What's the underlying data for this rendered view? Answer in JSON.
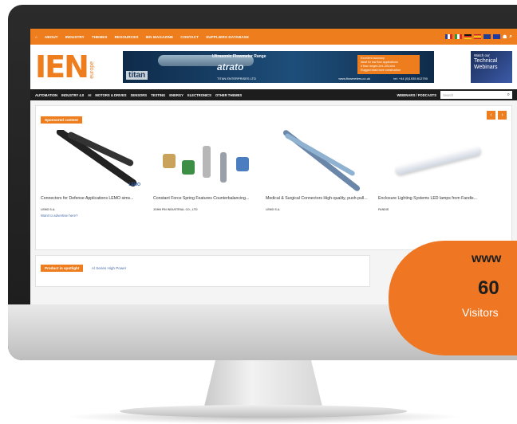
{
  "topbar": {
    "items": [
      "ABOUT",
      "INDUSTRY",
      "THEMES",
      "RESOURCES",
      "IEN MAGAZINE",
      "CONTACT",
      "SUPPLIERS DATABASE"
    ],
    "flags": [
      "fr",
      "it",
      "de",
      "es",
      "uk",
      "eu"
    ]
  },
  "logo": {
    "main": "IEN",
    "sub": "europe"
  },
  "banner": {
    "brand": "titan",
    "headline": "Ultrasonic Flowmeter Range",
    "product": "atrato",
    "company": "TITAN ENTERPRISES LTD",
    "bullets": [
      "Excellent accuracy",
      "Ideal for low flow applications",
      "4 flow ranges 2ml–20L/min",
      "Rugged trash bore construction"
    ],
    "url": "www.flowmeters.co.uk",
    "tel": "tel: +44 (0)1935 812790"
  },
  "webinars": {
    "small": "Watch our",
    "line1": "Technical",
    "line2": "Webinars"
  },
  "mainnav": {
    "items": [
      "AUTOMATION",
      "INDUSTRY 4.0",
      "AI",
      "MOTORS & DRIVES",
      "SENSORS",
      "TESTING",
      "ENERGY",
      "ELECTRONICS",
      "OTHER THEMES"
    ],
    "webinars_link": "WEBINARS / PODCASTS",
    "search_placeholder": "Search"
  },
  "sponsored": {
    "tag": "Sponsored content",
    "cards": [
      {
        "caption": "Connectors for Defense Applications LEMO sims...",
        "source": "LEMO S.A."
      },
      {
        "caption": "Constant Force Spring Features Counterbalancing...",
        "source": "JOHN FIN INDUSTRIAL CO., LTD"
      },
      {
        "caption": "Medical & Surgical Connectors High-quality, push-pull...",
        "source": "LEMO S.A."
      },
      {
        "caption": "Enclosure Lighting Systems LED lamps from Fandis...",
        "source": "FANDIS"
      }
    ],
    "subscribe_link": "Want to advertise here?"
  },
  "spotlight": {
    "tag": "Product in spotlight",
    "title": "Al Series High Power"
  },
  "callout": {
    "www": "www",
    "number": "60",
    "visitors": "Visitors"
  },
  "colors": {
    "accent": "#ee7d1e",
    "nav_dark": "#1d1d1d",
    "callout": "#ef7622"
  }
}
